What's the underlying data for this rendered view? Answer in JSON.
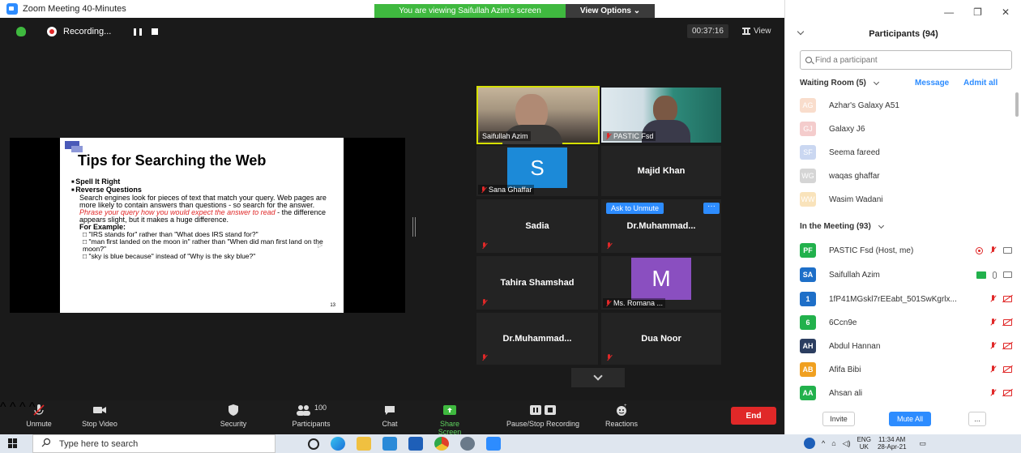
{
  "window": {
    "title": "Zoom Meeting 40-Minutes",
    "viewing_banner": "You are viewing Saifullah Azim's screen",
    "view_options": "View Options ⌄"
  },
  "topbar": {
    "recording_label": "Recording...",
    "timer": "00:37:16",
    "view_label": "View"
  },
  "slide": {
    "title": "Tips for Searching the Web",
    "bullet1": "Spell It Right",
    "bullet2": "Reverse Questions",
    "para1": "Search engines look for pieces of text that match your query. Web pages are more likely to contain answers than questions - so search for the answer.",
    "para_red": "Phrase your query how you would expect the answer to read",
    "para2": " - the difference appears slight, but it makes a huge difference.",
    "example_head": "For Example:",
    "ex1": "\"IRS stands for\" rather than \"What does IRS stand for?\"",
    "ex2": "\"man first landed on the moon in\" rather than \"When did man first land on the moon?\"",
    "ex3": "\"sky is blue because\" instead of \"Why is the sky blue?\"",
    "page": "13"
  },
  "tiles": {
    "t1": "Saifullah Azim",
    "t2": "PASTIC Fsd",
    "t3_name": "Sana Ghaffar",
    "t3_initial": "S",
    "t4": "Majid Khan",
    "t5": "Sadia",
    "t6": "Dr.Muhammad...",
    "t6_ask": "Ask to Unmute",
    "t6_more": "···",
    "t7": "Tahira Shamshad",
    "t8_name": "Ms. Romana ...",
    "t8_initial": "M",
    "t9": "Dr.Muhammad...",
    "t10": "Dua Noor"
  },
  "toolbar": {
    "unmute": "Unmute",
    "stop_video": "Stop Video",
    "security": "Security",
    "participants": "Participants",
    "participants_count": "100",
    "chat": "Chat",
    "share_screen": "Share Screen",
    "pause_recording": "Pause/Stop Recording",
    "reactions": "Reactions",
    "end": "End"
  },
  "panel": {
    "title": "Participants (94)",
    "search_placeholder": "Find a participant",
    "waiting_room": "Waiting Room (5)",
    "message": "Message",
    "admit_all": "Admit all",
    "waiting": [
      {
        "initials": "AG",
        "name": "Azhar's Galaxy A51",
        "color": "#f0a070"
      },
      {
        "initials": "GJ",
        "name": "Galaxy J6",
        "color": "#e07070"
      },
      {
        "initials": "SF",
        "name": "Seema fareed",
        "color": "#6a8fd8"
      },
      {
        "initials": "WG",
        "name": "waqas ghaffar",
        "color": "#888888"
      },
      {
        "initials": "WW",
        "name": "Wasim Wadani",
        "color": "#f0b040"
      }
    ],
    "in_meeting": "In the Meeting (93)",
    "members": [
      {
        "initials": "PF",
        "name": "PASTIC Fsd (Host, me)",
        "color": "#22b14c"
      },
      {
        "initials": "SA",
        "name": "Saifullah Azim",
        "color": "#1e6fc8"
      },
      {
        "initials": "1",
        "name": "1fP41MGskl7rEEabt_501SwKgrlx...",
        "color": "#1e6fc8"
      },
      {
        "initials": "6",
        "name": "6Ccn9e",
        "color": "#22b14c"
      },
      {
        "initials": "AH",
        "name": "Abdul Hannan",
        "color": "#2c3e60"
      },
      {
        "initials": "AB",
        "name": "Afifa Bibi",
        "color": "#f0a020"
      },
      {
        "initials": "AA",
        "name": "Ahsan ali",
        "color": "#22b14c"
      }
    ],
    "invite": "Invite",
    "mute_all": "Mute All",
    "more": "..."
  },
  "taskbar": {
    "search_placeholder": "Type here to search",
    "lang": "ENG",
    "region": "UK",
    "time": "11:34 AM",
    "date": "28-Apr-21"
  }
}
